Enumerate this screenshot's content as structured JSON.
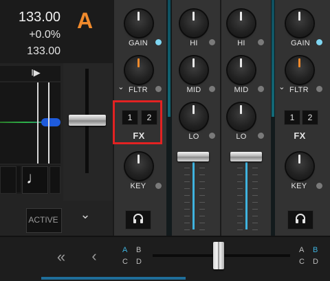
{
  "deck_a": {
    "bpm": "133.00",
    "pitch": "+0.0%",
    "tempo": "133.00",
    "letter": "A",
    "letter_color": "#f08a2c",
    "play_icon_label": "I▶",
    "note_icon": "♩",
    "active_label": "ACTIVE",
    "chevron": "⌄"
  },
  "mixer": {
    "left_channel": {
      "gain_label": "GAIN",
      "filter_label": "FLTR",
      "filter_chevron": "⌄",
      "fx_buttons": [
        "1",
        "2"
      ],
      "fx_label": "FX",
      "key_label": "KEY"
    },
    "eq_channel_1": {
      "hi_label": "HI",
      "mid_label": "MID",
      "lo_label": "LO"
    },
    "eq_channel_2": {
      "hi_label": "HI",
      "mid_label": "MID",
      "lo_label": "LO"
    },
    "right_channel": {
      "gain_label": "GAIN",
      "filter_label": "FLTR",
      "filter_chevron": "⌄",
      "fx_buttons": [
        "1",
        "2"
      ],
      "fx_label": "FX",
      "key_label": "KEY"
    },
    "channel_fader_1_level": 0.85,
    "channel_fader_2_level": 0.85
  },
  "crossfader_bar": {
    "rewind_icon": "«",
    "back_icon": "‹",
    "left_assign": [
      "A",
      "B",
      "C",
      "D"
    ],
    "right_assign": [
      "A",
      "B",
      "C",
      "D"
    ],
    "accent": "#3fb3df",
    "crossfader_position": 0.5
  },
  "highlight": {
    "color": "#e32222",
    "target": "FX assign buttons"
  }
}
